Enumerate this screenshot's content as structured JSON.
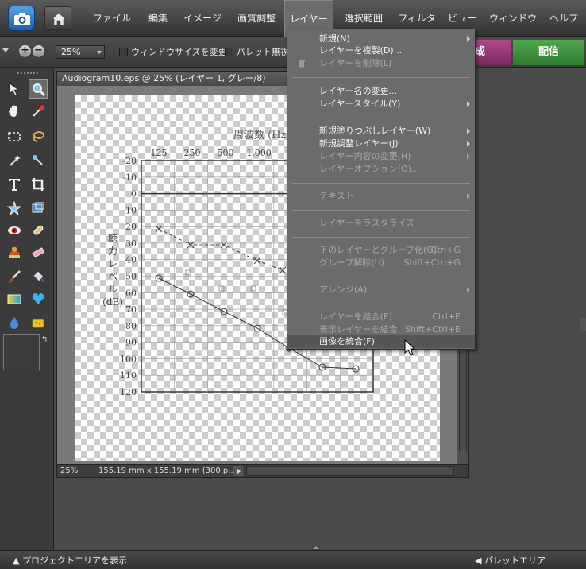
{
  "menubar": {
    "items": [
      "ファイル",
      "編集",
      "イメージ",
      "画質調整",
      "レイヤー",
      "選択範囲",
      "フィルタ",
      "ビュー",
      "ウィンドウ",
      "ヘルプ"
    ],
    "active": "レイヤー"
  },
  "options": {
    "zoom_value": "25%",
    "resize_window_label": "ウィンドウサイズを変更",
    "palette_label": "パレット無視",
    "create_tab": "成",
    "share_tab": "配信"
  },
  "document": {
    "title": "Audiogram10.eps @ 25% (レイヤー 1, グレー/8)",
    "status_zoom": "25%",
    "status_dims": "155.19 mm x 155.19 mm (300 p..."
  },
  "layer_menu": {
    "items": [
      {
        "label": "新規(N)",
        "enabled": true,
        "submenu": true
      },
      {
        "label": "レイヤーを複製(D)...",
        "enabled": true
      },
      {
        "label": "レイヤーを削除(L)",
        "enabled": false,
        "icon": "trash-icon"
      },
      {
        "label": "レイヤー名の変更...",
        "enabled": true
      },
      {
        "label": "レイヤースタイル(Y)",
        "enabled": true,
        "submenu": true
      },
      {
        "label": "新規塗りつぶしレイヤー(W)",
        "enabled": true,
        "submenu": true
      },
      {
        "label": "新規調整レイヤー(J)",
        "enabled": true,
        "submenu": true
      },
      {
        "label": "レイヤー内容の変更(H)",
        "enabled": false,
        "submenu": true
      },
      {
        "label": "レイヤーオプション(O)...",
        "enabled": false
      },
      {
        "label": "テキスト",
        "enabled": false,
        "submenu": true
      },
      {
        "label": "レイヤーをラスタライズ",
        "enabled": false
      },
      {
        "label": "下のレイヤーとグループ化(G)",
        "enabled": false,
        "shortcut": "Ctrl+G"
      },
      {
        "label": "グループ解除(U)",
        "enabled": false,
        "shortcut": "Shift+Ctrl+G"
      },
      {
        "label": "アレンジ(A)",
        "enabled": false,
        "submenu": true
      },
      {
        "label": "レイヤーを結合(E)",
        "enabled": false,
        "shortcut": "Ctrl+E"
      },
      {
        "label": "表示レイヤーを結合",
        "enabled": false,
        "shortcut": "Shift+Ctrl+E"
      },
      {
        "label": "画像を統合(F)",
        "enabled": true,
        "highlighted": true
      }
    ]
  },
  "audiogram": {
    "top_label": "周波数 (Hz)",
    "side_label_lines": [
      "聴",
      "力",
      "レ",
      "ベ",
      "ル",
      "(dB)"
    ],
    "freq_labels": [
      "125",
      "250",
      "500",
      "1,000",
      "2,"
    ],
    "level_labels": [
      "-20",
      "-10",
      "0",
      "10",
      "20",
      "30",
      "40",
      "50",
      "60",
      "70",
      "80",
      "90",
      "100",
      "110",
      "120"
    ]
  },
  "footer": {
    "project_area": "プロジェクトエリアを表示",
    "palette_area": "パレットエリア"
  }
}
